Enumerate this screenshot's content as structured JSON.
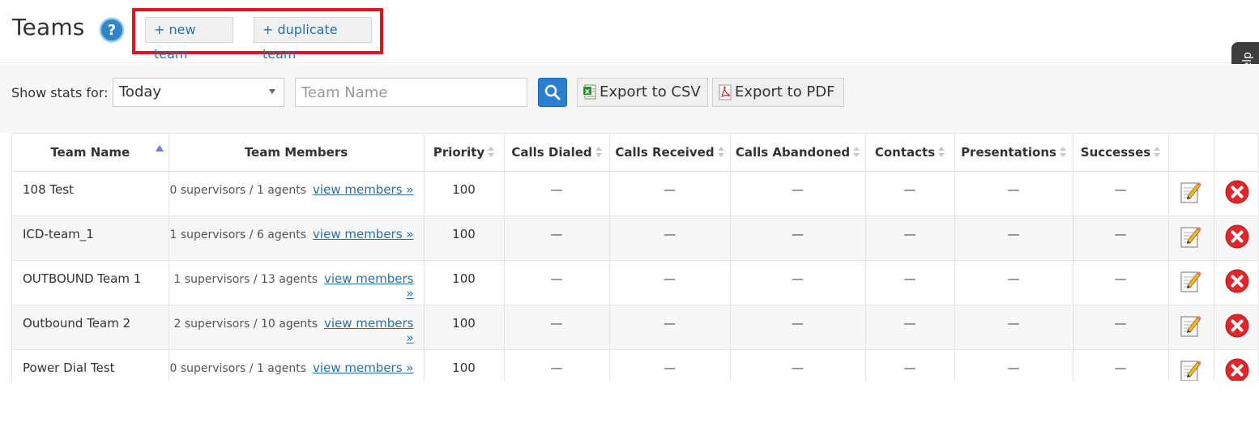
{
  "header": {
    "title": "Teams",
    "help_glyph": "?",
    "new_team_label": "+ new team",
    "duplicate_team_label": "+ duplicate team"
  },
  "help_tab": {
    "label": "Help"
  },
  "filter": {
    "show_stats_label": "Show stats for:",
    "period_value": "Today",
    "team_name_placeholder": "Team Name",
    "export_csv_label": "Export to CSV",
    "export_pdf_label": "Export to PDF"
  },
  "table": {
    "columns": [
      "Team Name",
      "Team Members",
      "Priority",
      "Calls Dialed",
      "Calls Received",
      "Calls Abandoned",
      "Contacts",
      "Presentations",
      "Successes"
    ],
    "view_members_label": "view members »",
    "rows": [
      {
        "name": "108 Test",
        "members": "0  supervisors / 1 agents",
        "priority": "100",
        "calls_dialed": "—",
        "calls_received": "—",
        "calls_abandoned": "—",
        "contacts": "—",
        "presentations": "—",
        "successes": "—"
      },
      {
        "name": "ICD-team_1",
        "members": "1  supervisors / 6 agents",
        "priority": "100",
        "calls_dialed": "—",
        "calls_received": "—",
        "calls_abandoned": "—",
        "contacts": "—",
        "presentations": "—",
        "successes": "—"
      },
      {
        "name": "OUTBOUND Team 1",
        "members": "1  supervisors / 13 agents",
        "priority": "100",
        "calls_dialed": "—",
        "calls_received": "—",
        "calls_abandoned": "—",
        "contacts": "—",
        "presentations": "—",
        "successes": "—"
      },
      {
        "name": "Outbound Team 2",
        "members": "2  supervisors / 10 agents",
        "priority": "100",
        "calls_dialed": "—",
        "calls_received": "—",
        "calls_abandoned": "—",
        "contacts": "—",
        "presentations": "—",
        "successes": "—"
      },
      {
        "name": "Power Dial Test",
        "members": "0  supervisors / 1 agents",
        "priority": "100",
        "calls_dialed": "—",
        "calls_received": "—",
        "calls_abandoned": "—",
        "contacts": "—",
        "presentations": "—",
        "successes": "—"
      }
    ]
  },
  "icons": {
    "help": "question-circle-icon",
    "search": "search-icon",
    "csv": "excel-file-icon",
    "pdf": "pdf-file-icon",
    "edit": "edit-pencil-icon",
    "delete": "delete-x-icon"
  },
  "colors": {
    "link": "#2a6fa8",
    "highlight": "#e0141e",
    "search_button": "#2b7fd1",
    "delete": "#e0262b"
  }
}
